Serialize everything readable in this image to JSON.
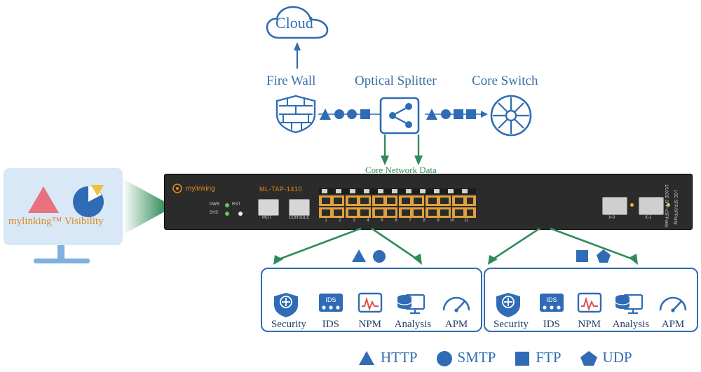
{
  "diagram": {
    "title_nodes": {
      "cloud": "Cloud",
      "firewall": "Fire Wall",
      "splitter": "Optical Splitter",
      "core_switch": "Core Switch",
      "core_network_data": "Core Network Data"
    },
    "device": {
      "brand": "mylinking",
      "model": "ML-TAP-1410",
      "led_labels": [
        "PWR",
        "RST",
        "SYS"
      ],
      "port_labels": [
        "MGT",
        "CONSOLE"
      ],
      "sfp_labels": [
        "X-0",
        "X-1"
      ],
      "side_text_top": "1/10GE SFP+/SFPonly",
      "side_text_bottom": "1GE SFP/SFPonly",
      "port_index_labels": [
        "1",
        "2",
        "3",
        "4",
        "5",
        "6",
        "7",
        "8",
        "9",
        "10",
        "11"
      ]
    },
    "monitor": {
      "caption": "mylinking™ Visibility"
    },
    "tool_groups": [
      {
        "markers": [
          "triangle",
          "circle"
        ],
        "tools": [
          {
            "label": "Security",
            "icon": "shield-plus-icon"
          },
          {
            "label": "IDS",
            "icon": "ids-icon"
          },
          {
            "label": "NPM",
            "icon": "waveform-monitor-icon"
          },
          {
            "label": "Analysis",
            "icon": "database-screen-icon"
          },
          {
            "label": "APM",
            "icon": "gauge-icon"
          }
        ]
      },
      {
        "markers": [
          "square",
          "pentagon"
        ],
        "tools": [
          {
            "label": "Security",
            "icon": "shield-plus-icon"
          },
          {
            "label": "IDS",
            "icon": "ids-icon"
          },
          {
            "label": "NPM",
            "icon": "waveform-monitor-icon"
          },
          {
            "label": "Analysis",
            "icon": "database-screen-icon"
          },
          {
            "label": "APM",
            "icon": "gauge-icon"
          }
        ]
      }
    ],
    "legend": [
      {
        "shape": "triangle",
        "label": "HTTP"
      },
      {
        "shape": "circle",
        "label": "SMTP"
      },
      {
        "shape": "square",
        "label": "FTP"
      },
      {
        "shape": "pentagon",
        "label": "UDP"
      }
    ],
    "colors": {
      "blue": "#2f6cb5",
      "green": "#2e8b57",
      "device": "#2b2b2b",
      "orange": "#e08a1e",
      "panel": "#d9e8f7"
    }
  }
}
